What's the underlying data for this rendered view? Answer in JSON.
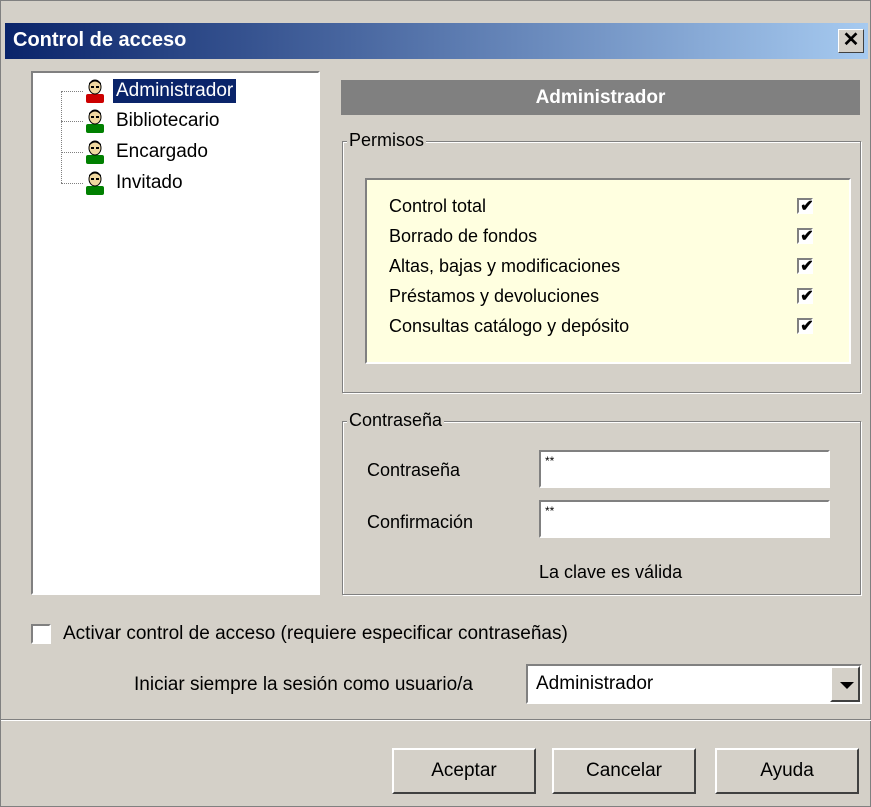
{
  "window": {
    "title": "Control de acceso",
    "close_symbol": "✕"
  },
  "tree": {
    "items": [
      {
        "label": "Administrador",
        "selected": true,
        "icon": "user-admin-icon"
      },
      {
        "label": "Bibliotecario",
        "selected": false,
        "icon": "user-icon"
      },
      {
        "label": "Encargado",
        "selected": false,
        "icon": "user-icon"
      },
      {
        "label": "Invitado",
        "selected": false,
        "icon": "user-icon"
      }
    ]
  },
  "role_header": "Administrador",
  "permissions": {
    "title": "Permisos",
    "items": [
      {
        "label": "Control total",
        "checked": true
      },
      {
        "label": "Borrado de fondos",
        "checked": true
      },
      {
        "label": "Altas, bajas y modificaciones",
        "checked": true
      },
      {
        "label": "Préstamos y devoluciones",
        "checked": true
      },
      {
        "label": "Consultas catálogo y depósito",
        "checked": true
      }
    ]
  },
  "password": {
    "title": "Contraseña",
    "password_label": "Contraseña",
    "password_value": "**",
    "confirm_label": "Confirmación",
    "confirm_value": "**",
    "status": "La clave es válida"
  },
  "activate": {
    "label": "Activar control de acceso (requiere especificar contraseñas)",
    "checked": false
  },
  "session": {
    "label": "Iniciar siempre la sesión como usuario/a",
    "value": "Administrador"
  },
  "buttons": {
    "accept": "Aceptar",
    "cancel": "Cancelar",
    "help": "Ayuda"
  },
  "colors": {
    "titlebar_start": "#0a246a",
    "titlebar_end": "#a6caf0",
    "dialog_bg": "#d4d0c8",
    "selected_bg": "#0a246a",
    "permissions_bg": "#ffffe0",
    "header_bg": "#808080"
  }
}
